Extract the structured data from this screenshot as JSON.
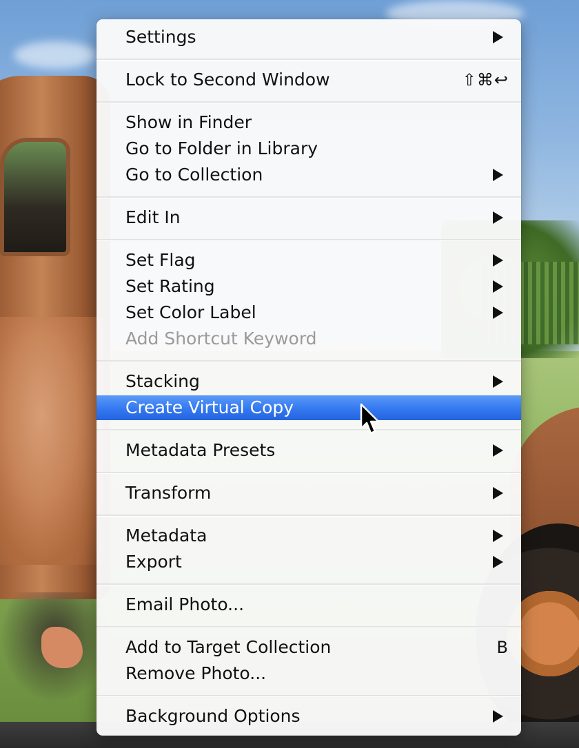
{
  "menu": {
    "items": [
      {
        "label": "Settings",
        "submenu": true
      },
      {
        "label": "Lock to Second Window",
        "shortcut": "⇧⌘↩"
      },
      {
        "label": "Show in Finder"
      },
      {
        "label": "Go to Folder in Library"
      },
      {
        "label": "Go to Collection",
        "submenu": true
      },
      {
        "label": "Edit In",
        "submenu": true
      },
      {
        "label": "Set Flag",
        "submenu": true
      },
      {
        "label": "Set Rating",
        "submenu": true
      },
      {
        "label": "Set Color Label",
        "submenu": true
      },
      {
        "label": "Add Shortcut Keyword",
        "disabled": true
      },
      {
        "label": "Stacking",
        "submenu": true
      },
      {
        "label": "Create Virtual Copy",
        "highlighted": true
      },
      {
        "label": "Metadata Presets",
        "submenu": true
      },
      {
        "label": "Transform",
        "submenu": true
      },
      {
        "label": "Metadata",
        "submenu": true
      },
      {
        "label": "Export",
        "submenu": true
      },
      {
        "label": "Email Photo..."
      },
      {
        "label": "Add to Target Collection",
        "shortcut": "B"
      },
      {
        "label": "Remove Photo..."
      },
      {
        "label": "Background Options",
        "submenu": true
      }
    ]
  },
  "colors": {
    "highlight": "#3478f0",
    "text": "#111111",
    "disabled_text": "#9a9a9a"
  },
  "icons": {
    "submenu": "chevron-right-icon",
    "cursor": "arrow-cursor-icon"
  }
}
